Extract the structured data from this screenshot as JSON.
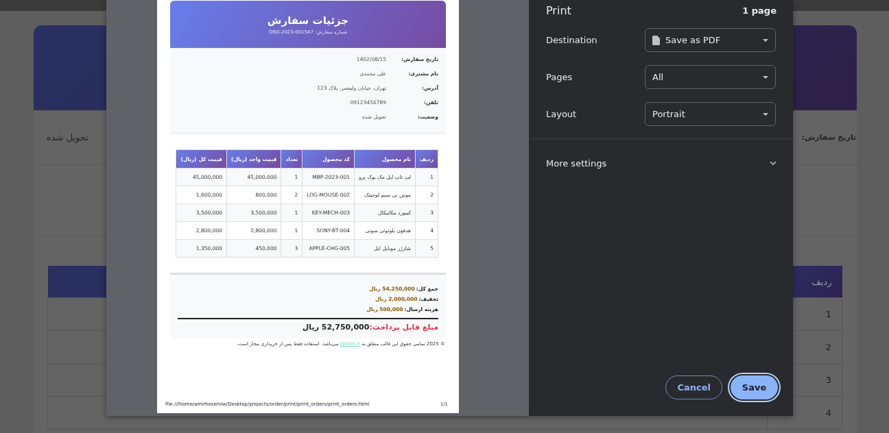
{
  "background_page": {
    "status_value": "تحویل شده",
    "date_label": "تاریخ سفارش:",
    "table": {
      "columns": [
        "ردیف"
      ],
      "rows": [
        "1",
        "2",
        "3",
        "4"
      ]
    }
  },
  "print_preview": {
    "page": {
      "title": "جزئیات سفارش",
      "order_number": "شماره سفارش: ORD-2023-001547",
      "info": [
        {
          "label": "تاریخ سفارش:",
          "value": "1402/08/15"
        },
        {
          "label": "نام مشتری:",
          "value": "علی محمدی"
        },
        {
          "label": "آدرس:",
          "value": "تهران، خیابان ولیعصر، پلاک 123"
        },
        {
          "label": "تلفن:",
          "value": "09123456789"
        },
        {
          "label": "وضعیت:",
          "value": "تحویل شده"
        }
      ],
      "table": {
        "columns": [
          "ردیف",
          "نام محصول",
          "کد محصول",
          "تعداد",
          "قیمت واحد (ریال)",
          "قیمت کل (ریال)"
        ],
        "rows": [
          [
            "1",
            "لپ تاپ اپل مک بوک پرو",
            "MBP-2023-001",
            "1",
            "45,000,000",
            "45,000,000"
          ],
          [
            "2",
            "موس بی سیم لوجیتک",
            "LOG-MOUSE-002",
            "2",
            "800,000",
            "1,600,000"
          ],
          [
            "3",
            "کیبورد مکانیکال",
            "KEY-MECH-003",
            "1",
            "3,500,000",
            "3,500,000"
          ],
          [
            "4",
            "هدفون بلوتوثی سونی",
            "SONY-BT-004",
            "1",
            "2,800,000",
            "2,800,000"
          ],
          [
            "5",
            "شارژر موبایل اپل",
            "APPLE-CHG-005",
            "3",
            "450,000",
            "1,350,000"
          ]
        ]
      },
      "summary": [
        {
          "label": "جمع کل:",
          "value": "54,250,000 ریال"
        },
        {
          "label": "تخفیف:",
          "value": "2,000,000 ریال"
        },
        {
          "label": "هزینه ارسال:",
          "value": "500,000 ریال"
        }
      ],
      "grand_total": {
        "label": "مبلغ قابل پرداخت:",
        "value": "52,750,000 ریال"
      },
      "footer": {
        "before": "© 2025 تمامی حقوق این قالب متعلق به",
        "link": "tamlin.ir",
        "after": "می‌باشد. استفاده فقط پس از خریداری مجاز است."
      },
      "url": "file:///home/amirhoseniiw/Desktop/projects/order/print/print_orders/print_orders.html",
      "page_number": "1/1"
    }
  },
  "print_settings": {
    "title": "Print",
    "page_count": "1 page",
    "fields": [
      {
        "label": "Destination",
        "value": "Save as PDF",
        "kind": "file"
      },
      {
        "label": "Pages",
        "value": "All",
        "kind": "plain"
      },
      {
        "label": "Layout",
        "value": "Portrait",
        "kind": "plain"
      }
    ],
    "more_settings": {
      "label": "More settings",
      "expanded": false
    },
    "cancel_button": {
      "label": "Cancel"
    },
    "save_button": {
      "label": "Save"
    }
  }
}
